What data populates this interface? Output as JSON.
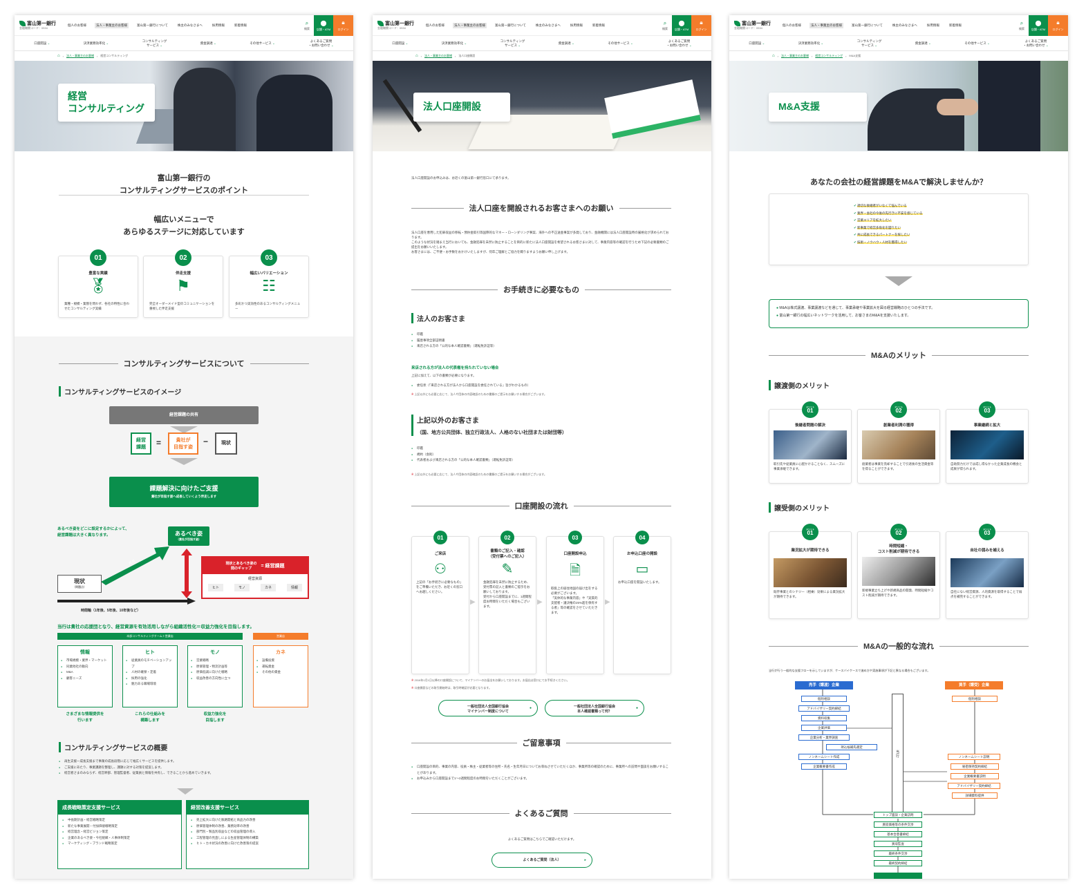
{
  "header": {
    "logo_name": "富山第一銀行",
    "bank_code": "金融機関コード：0534",
    "top_nav": [
      "個人のお客様",
      "法人・事業主のお客様",
      "富山第一銀行について",
      "株主のみなさまへ",
      "採用情報",
      "新着情報"
    ],
    "search_label": "検索",
    "atm_label": "店舗・ATM",
    "login_label": "ログイン",
    "global_nav": [
      "口座開設",
      "決済業務効率化",
      "コンサルティング\nサービス",
      "資金調達",
      "その他サービス",
      "よくあるご質問\n・お問い合わせ"
    ]
  },
  "p1": {
    "breadcrumb": [
      "法人・事業主のお客様",
      "経営コンサルティング"
    ],
    "hero_title": "経営\nコンサルティング",
    "points_title": "富山第一銀行の\nコンサルティングサービスのポイント",
    "points_sub": "幅広いメニューで\nあらゆるステージに対応しています",
    "points": [
      {
        "num": "01",
        "title": "豊富な実績",
        "text": "業種・規模・業態を問わず、各社の特性に合わせたコンサルティング実績"
      },
      {
        "num": "02",
        "title": "伴走支援",
        "text": "完全オーダーメイド型のコミュニケーションを重視した伴走支援"
      },
      {
        "num": "03",
        "title": "幅広いバリエーション",
        "text": "多彩かつ実効性のあるコンサルティングメニュー"
      }
    ],
    "about_title": "コンサルティングサービスについて",
    "image_title": "コンサルティングサービスのイメージ",
    "share_label": "経営課題の共有",
    "eq_left": "経営\n課題",
    "eq_mid": "貴社が\n目指す姿",
    "eq_right": "現状",
    "support_label": "課題解決に向けたご支援",
    "support_sub": "貴社が目指す姿へ成長していくよう伴走します",
    "ideal_note": "あるべき姿をどこに設定するかによって、\n経営課題は大きく異なります。",
    "ideal_label": "あるべき姿",
    "ideal_sub": "（貴社が目指す姿）",
    "growth_label": "成長",
    "current_label": "現状",
    "current_sub": "（問題点）",
    "gap_label": "現状とあるべき姿の\n間のギャップ",
    "gap_eq": "= 経営課題",
    "resources_label": "経営資源",
    "resources": [
      "ヒト",
      "モノ",
      "カネ",
      "情報"
    ],
    "time_label": "時間軸（1年後、5年後、10年後など）",
    "green_statement": "当行は貴社の応援団となり、経営資源を有効活用しながら組織活性化＝収益力強化を目指します。",
    "team_label": "本部コンサルティングチーム＋営業店",
    "branch_label": "営業店",
    "res_boxes": [
      {
        "title": "情報",
        "items": [
          "市場規模・業界・マーケット",
          "同業他社の動向",
          "M&A",
          "顧客ニーズ"
        ]
      },
      {
        "title": "ヒト",
        "items": [
          "従業員のモチベーションアップ",
          "人材の確保・定着",
          "採用の強化",
          "魅力ある職場環境"
        ]
      },
      {
        "title": "モノ",
        "items": [
          "営業戦略",
          "原価管理・物流計画等",
          "原価低減に向けた戦略",
          "収益改善の方向性に立つ"
        ]
      },
      {
        "title": "カネ",
        "items": [
          "設備投資",
          "運転資金",
          "その他の資金"
        ]
      }
    ],
    "res_captions": [
      "さまざまな情報提供を\n行います",
      "これらの仕組みを\n構築します",
      "収益力強化を\n目指します"
    ],
    "overview_title": "コンサルティングサービスの概要",
    "overview_items": [
      "再生支援一成長支援まで事業の成長段階に応じて幅広くサービスを提供します。",
      "ご支援にあたり、事業課題を整理し、課題に対する対策を提案します。",
      "経営者さまのみならず、経営幹部、管理監督者、従業員と情報を共有し、できることから進めていきます。"
    ],
    "svc1_title": "成長戦略策定支援サービス",
    "svc1_items": [
      "中長期計画・経営戦略策定",
      "新たな事業展開・付加価値戦略策定",
      "経営理念・経営ビジョン策定",
      "企業のあるべき姿・今社組織・人事体制策定",
      "マーケティング・ブランド戦略策定"
    ],
    "svc2_title": "経営改善支援サービス",
    "svc2_items": [
      "売上拡大に向けた販路開拓と商品力の改善",
      "原価管理体制の改善、業務効率の改善",
      "部門別・製品別収益などの収益管理の導入",
      "工程管理の見直しによる生産管理体制の構築",
      "ヒト・カネ状況の改善に向けた改善策の提案"
    ]
  },
  "p2": {
    "breadcrumb": [
      "法人・事業主のお客様",
      "法人口座開設"
    ],
    "hero_title": "法人口座開設",
    "intro": "法人口座開設のお申込みは、お近くの富山第一銀行窓口にて承ります。",
    "request_title": "法人口座を開設されるお客さまへのお願い",
    "request_text": "法人口座を悪用した犯罪収益の移転・預貯金取引等国際的なマネー・ローンダリング事案、海外への不正送金事案が多発しており、金融機関には法人口座開設時の厳格化が求められております。\nこのような状況を踏まえ当行においても、金融犯罪を未然に防止することを目的に新たに法人口座開設を希望されるお客さまに対して、事業内容等の確認を行うため下記の必要書類のご提出をお願いいたします。\nお客さまには、ご不便・お手数をおかけいたしますが、何卒ご理解とご協力を賜りますようお願い申し上げます。",
    "proc_title": "お手続きに必要なもの",
    "corp_title": "法人のお客さま",
    "corp_items": [
      "印鑑",
      "履歴事項全部証明書",
      "来店される方の「公的な本人確認書類」（運転免許証等）"
    ],
    "rep_note_title": "来店される方が法人の代表権を持たれていない場合",
    "rep_note_text": "上記に加えて、以下の書類が必要になります。",
    "rep_items": [
      "委任状（「来店される方が法人から口座開設を委任されている」旨がわかるもの）"
    ],
    "rep_asterisk": "上記以外にも必要に応じて、法人や団体の内容確認のための書類のご提示をお願いする場合がございます。",
    "other_title": "上記以外のお客さま",
    "other_sub": "（国、地方公共団体、独立行政法人、人格のない社団または財団等）",
    "other_items": [
      "印鑑",
      "規約（会則）",
      "代表者および来店される方の「公的な本人確認書類」（運転免許証等）"
    ],
    "other_asterisk": "上記以外にも必要に応じて、法人や団体の内容確認のための書類のご提示をお願いする場合がございます。",
    "flow_title": "口座開設の流れ",
    "flow_steps": [
      {
        "num": "01",
        "title": "ご来店",
        "text": "上記の「お手続きに必要なもの」をご準備いただき、お近くの窓口へお越しください。"
      },
      {
        "num": "02",
        "title": "書類のご記入・確認\n（受付票へのご記入）",
        "text": "金融犯罪を未然に防止するため、受付票の記入と書類のご提示をお願いしております。\n受付から口座開設までに、1週間程度お時間をいただく場合もございます。"
      },
      {
        "num": "03",
        "title": "口座開設申込",
        "text": "取扱上の居住地国の届け出をする必要がございます。\n「実体的な事業内容」や「実質的支配者・議決権の25%超を保有する者」等の確認をさせていただきます。"
      },
      {
        "num": "04",
        "title": "お申込口座の開設",
        "text": "お申込口座を開設いたします。"
      }
    ],
    "flow_notes": [
      "2016年1月1日以降の口座開設について、マイナンバーのお届出をお願いしております。お届出は窓口にてお手続きください。",
      "口座開設などの取引開始時は、取引時確認が必要となります。"
    ],
    "btn1": "一般社団法人全国銀行協会\nマイナンバー制度について",
    "btn2": "一般社団法人全国銀行協会\n本人確認書類って何？",
    "caution_title": "ご留意事項",
    "caution_items": [
      "口座開設の目的、事業の内容、役員・株主・従業者等の住所・氏名・生年月日についてお尋ねさせていただくほか、事業所等の確認のために、事業所への訪問や面談をお願いすることがあります。",
      "お申込みから口座開設まで1〜2週間程度のお時間をいただくことがございます。"
    ],
    "faq_title": "よくあるご質問",
    "faq_text": "よくあるご質問はこちらでご確認いただけます。",
    "faq_btn": "よくあるご質問（法人）"
  },
  "p3": {
    "breadcrumb": [
      "法人・事業主のお客様",
      "経営コンサルティング",
      "M&A支援"
    ],
    "hero_title": "M&A支援",
    "question": "あなたの会社の経営課題をM&Aで解決しませんか？",
    "checks": [
      "適切な後継者がいなくて悩んでいる",
      "業界・会社の今後の先行きに不安を感じている",
      "営業エリアを拡大したい",
      "新事業で経営多角化を図りたい",
      "共に成長できるパートナーを探したい",
      "技術・ノウハウ・人材を獲得したい"
    ],
    "summary": [
      "M&Aは株式譲渡、事業譲渡などを通じて、事業承継や事業拡大を図る経営戦略のひとつの手法です。",
      "富山第一銀行の幅広いネットワークを活用して、お客さまのM&Aを支援いたします。"
    ],
    "merit_title": "M&Aのメリット",
    "seller_title": "譲渡側のメリット",
    "buyer_title": "譲受側のメリット",
    "merit_label": "メリット",
    "seller_merits": [
      {
        "num": "01",
        "title": "後継者問題の解決",
        "text": "取引先や従業員に心配かけることなく、スムーズに事業承継できます。"
      },
      {
        "num": "02",
        "title": "創業者利潤の獲得",
        "text": "創業者は事業を売却することで引退後の生活資金等を得ることができます。"
      },
      {
        "num": "03",
        "title": "事業継続と拡大",
        "text": "自助努力だけでは成し得なかった企業成長の機会と成果が得られます。"
      }
    ],
    "buyer_merits": [
      {
        "num": "01",
        "title": "業況拡大が期待できる",
        "text": "既存事業とのシナジー（相乗）効果による業況拡大が期待できます。"
      },
      {
        "num": "02",
        "title": "時間短縮・\nコスト削減が期待できる",
        "text": "新規事業立ち上げや新規商品の開発、時間短縮やコスト削減が期待できます。"
      },
      {
        "num": "03",
        "title": "自社の弱みを補える",
        "text": "自社にない経営資源、人的資源を取得することで弱点を補完することができます。"
      }
    ],
    "flow_title": "M&Aの一般的な流れ",
    "flow_note": "当行が行う一般的な支援フローを示していますが、ケースバイケースで進め方や実施事項が下記と異なる場合もございます。",
    "seller_head": "売手（譲渡）企業",
    "buyer_head": "買手（譲受）企業",
    "center_label": "当\n行",
    "seller_steps": [
      "個別相談",
      "アドバイザリー契約締結",
      "資料収集",
      "企業評価",
      "企業分析・業界調査",
      "持込候補先選定",
      "ノンネームシート作成",
      "企業概要書作成"
    ],
    "buyer_steps": [
      "個別相談",
      "ノンネームシート説明",
      "秘密保持契約締結",
      "企業概要書説明",
      "アドバイザリー契約締結",
      "詳細資料提供"
    ],
    "common_steps": [
      "トップ面談・企業訪問",
      "買収価格等の条件交渉",
      "基本合意書締結",
      "買収監査",
      "最終条件交渉",
      "最終契約締結"
    ]
  },
  "colors": {
    "brand_green": "#0a8f4c",
    "accent_orange": "#f47c2b",
    "alert_red": "#d9222a",
    "flow_blue": "#2a6bd0"
  }
}
